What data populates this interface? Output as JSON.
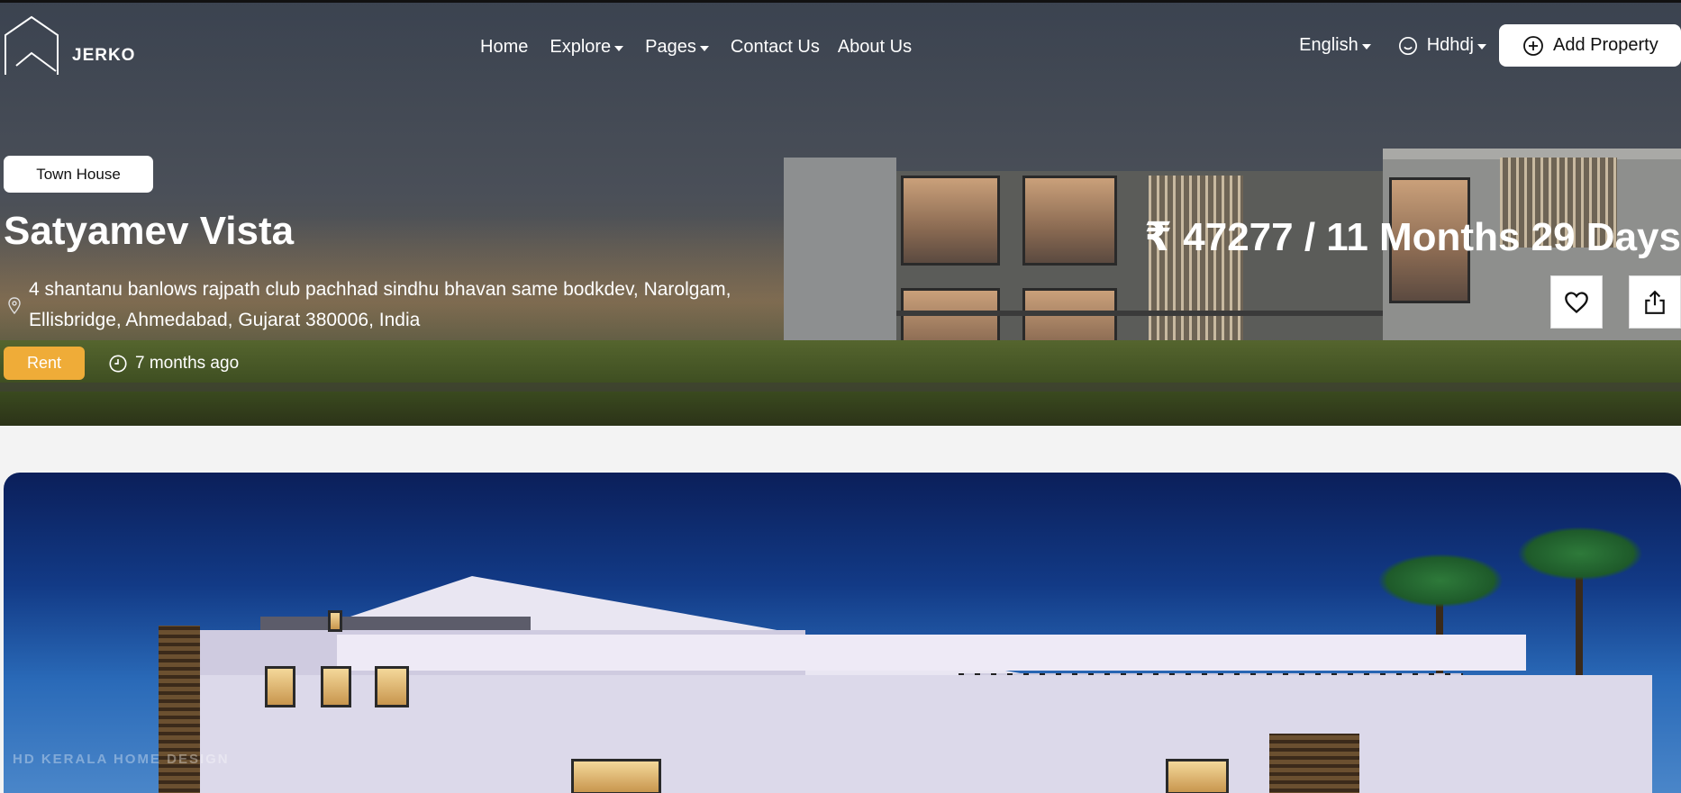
{
  "brand": {
    "name": "JERKO"
  },
  "nav": {
    "links": [
      {
        "label": "Home",
        "dropdown": false
      },
      {
        "label": "Explore",
        "dropdown": true
      },
      {
        "label": "Pages",
        "dropdown": true
      },
      {
        "label": "Contact Us",
        "dropdown": false
      },
      {
        "label": "About Us",
        "dropdown": false
      }
    ],
    "language": "English",
    "user": "Hdhdj",
    "add_property": "Add Property"
  },
  "property": {
    "type": "Town House",
    "title": "Satyamev Vista",
    "price": "₹ 47277 / 11 Months 29 Days",
    "address": "4 shantanu banlows rajpath club pachhad sindhu bhavan same bodkdev, Narolgam, Ellisbridge, Ahmedabad, Gujarat 380006, India",
    "status": "Rent",
    "posted": "7 months ago"
  },
  "gallery": {
    "watermark": "HD  KERALA HOME DESIGN"
  },
  "colors": {
    "rent_badge": "#efac38",
    "page_bg": "#f3f3f3"
  },
  "icons": [
    "logo-house-icon",
    "caret-down-icon",
    "smile-icon",
    "plus-circle-icon",
    "map-pin-icon",
    "clock-icon",
    "heart-icon",
    "share-icon"
  ]
}
